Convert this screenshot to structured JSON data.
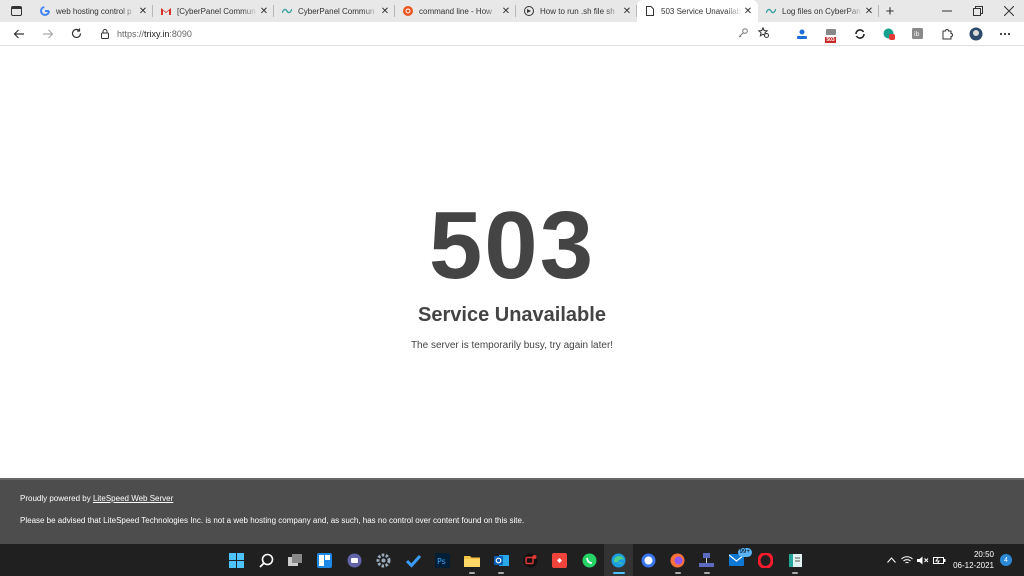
{
  "browser": {
    "tabs": [
      {
        "title": "web hosting control p",
        "favicon": "google-icon"
      },
      {
        "title": "[CyberPanel Commun",
        "favicon": "gmail-icon"
      },
      {
        "title": "CyberPanel Commun",
        "favicon": "cyberpanel-icon"
      },
      {
        "title": "command line - How",
        "favicon": "askubuntu-icon"
      },
      {
        "title": "How to run .sh file sh",
        "favicon": "stack-icon"
      },
      {
        "title": "503 Service Unavailab",
        "favicon": "page-icon",
        "active": true
      },
      {
        "title": "Log files on CyberPan",
        "favicon": "cyberpanel-icon"
      }
    ],
    "url": {
      "scheme": "https://",
      "host": "trixy.in",
      "port": ":8090"
    },
    "extension_badge": "503"
  },
  "page": {
    "code": "503",
    "title": "Service Unavailable",
    "message": "The server is temporarily busy, try again later!"
  },
  "footer": {
    "powered_prefix": "Proudly powered by ",
    "powered_link": "LiteSpeed Web Server",
    "disclaimer": "Please be advised that LiteSpeed Technologies Inc. is not a web hosting company and, as such, has no control over content found on this site."
  },
  "taskbar": {
    "apps": [
      "start-icon",
      "search-icon",
      "task-view-icon",
      "widgets-icon",
      "teams-chat-icon",
      "settings-icon",
      "todo-icon",
      "photoshop-icon",
      "file-explorer-icon",
      "outlook-icon",
      "screen-recorder-icon",
      "anydesk-icon",
      "whatsapp-icon",
      "edge-icon",
      "signal-icon",
      "firefox-icon",
      "network-app-icon",
      "mail-icon",
      "opera-icon",
      "notepad-icon"
    ],
    "mail_badge": "99+",
    "time": "20:50",
    "date": "06-12-2021",
    "notifications": "4"
  },
  "colors": {
    "text": "#444444",
    "footer_bg": "#4d4d4d",
    "taskbar_bg": "#202020"
  }
}
